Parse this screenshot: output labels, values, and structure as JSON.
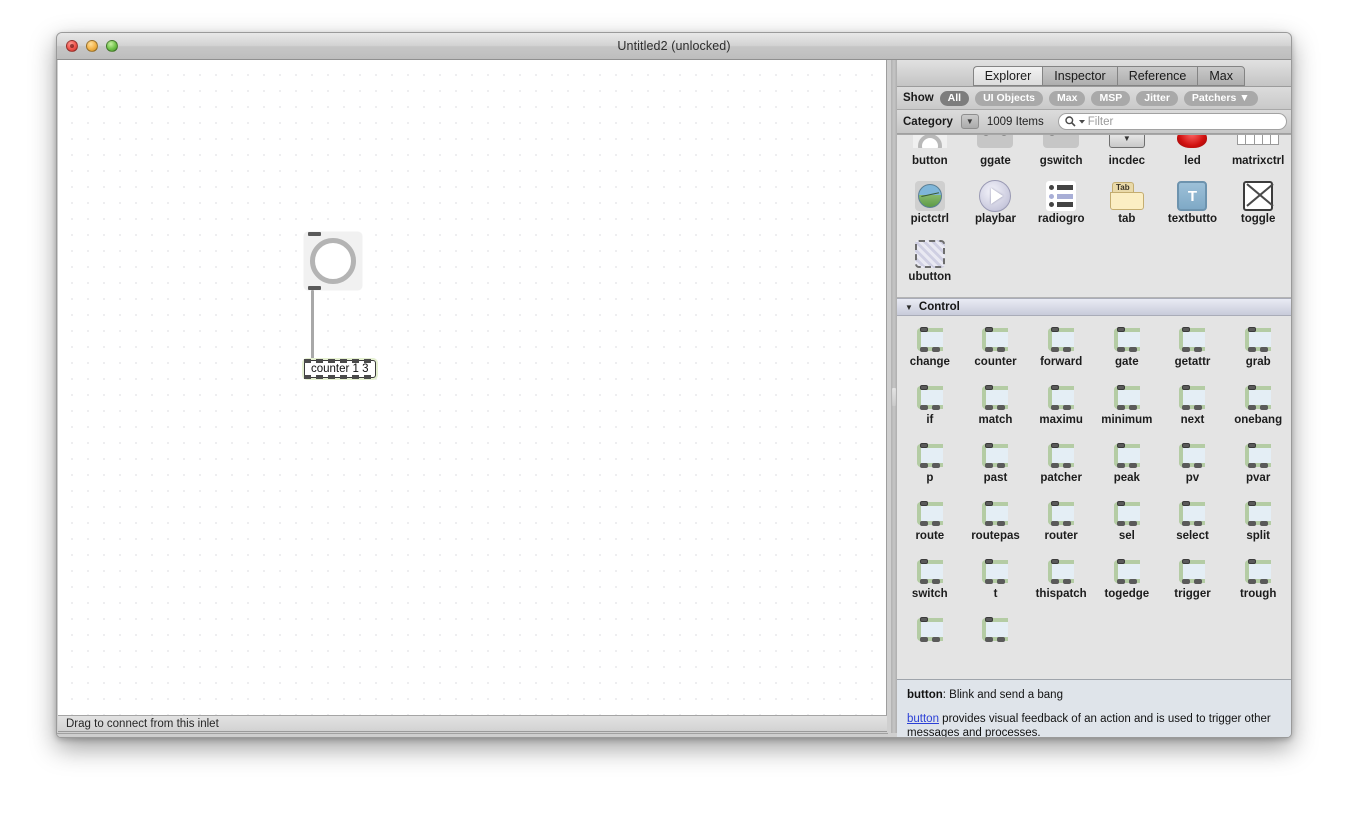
{
  "window": {
    "title": "Untitled2 (unlocked)",
    "traffic_lights": [
      "close",
      "minimize",
      "zoom"
    ]
  },
  "patcher": {
    "status_text": "Drag to connect from this inlet",
    "objects": [
      {
        "type": "bang",
        "name": "button"
      },
      {
        "type": "object-box",
        "text": "counter 1 3",
        "selected": true
      }
    ],
    "toolbar_left": [
      {
        "name": "unlock-edit-icon",
        "glyph": "lock-open"
      },
      {
        "name": "presentation-mode-icon",
        "glyph": "squares"
      },
      {
        "name": "add-object-icon",
        "glyph": "bang-tools"
      },
      {
        "name": "delete-object-icon",
        "glyph": "x-box"
      },
      {
        "name": "signal-probe-icon",
        "glyph": "scope"
      },
      {
        "name": "inspector-icon",
        "glyph": "info"
      },
      {
        "name": "snap-icon",
        "glyph": "pill"
      },
      {
        "name": "grid-icon",
        "glyph": "grid"
      },
      {
        "name": "audio-status-icon",
        "glyph": "meter"
      }
    ],
    "toolbar_right": [
      {
        "name": "bottom-panel-toggle",
        "glyph": "panel-bottom"
      },
      {
        "name": "side-panel-toggle",
        "glyph": "panel-side"
      }
    ]
  },
  "sidebar": {
    "tabs": [
      {
        "label": "Explorer",
        "active": true
      },
      {
        "label": "Inspector",
        "active": false
      },
      {
        "label": "Reference",
        "active": false
      },
      {
        "label": "Max",
        "active": false
      }
    ],
    "show": {
      "label": "Show",
      "filters": [
        {
          "label": "All",
          "active": true
        },
        {
          "label": "UI Objects",
          "active": false
        },
        {
          "label": "Max",
          "active": false
        },
        {
          "label": "MSP",
          "active": false
        },
        {
          "label": "Jitter",
          "active": false
        },
        {
          "label": "Patchers ▼",
          "active": false
        }
      ]
    },
    "category": {
      "label": "Category",
      "arrow": "▼",
      "items_count": "1009 Items",
      "search_placeholder": "Filter",
      "search_value": ""
    },
    "ui_objects": [
      {
        "label": "button",
        "icon": "bang-icon"
      },
      {
        "label": "ggate",
        "icon": "ggate-icon"
      },
      {
        "label": "gswitch",
        "icon": "gswitch-icon"
      },
      {
        "label": "incdec",
        "icon": "incdec-icon"
      },
      {
        "label": "led",
        "icon": "led-icon"
      },
      {
        "label": "matrixctrl",
        "icon": "matrixctrl-icon"
      },
      {
        "label": "pictctrl",
        "icon": "pictctrl-icon"
      },
      {
        "label": "playbar",
        "icon": "playbar-icon"
      },
      {
        "label": "radiogro",
        "icon": "radiogroup-icon"
      },
      {
        "label": "tab",
        "icon": "tab-icon"
      },
      {
        "label": "textbutto",
        "icon": "textbutton-icon"
      },
      {
        "label": "toggle",
        "icon": "toggle-icon"
      },
      {
        "label": "ubutton",
        "icon": "ubutton-icon"
      }
    ],
    "control_section": {
      "title": "Control",
      "expanded": true,
      "triangle": "▼",
      "objects": [
        "change",
        "counter",
        "forward",
        "gate",
        "getattr",
        "grab",
        "if",
        "match",
        "maximu",
        "minimum",
        "next",
        "onebang",
        "p",
        "past",
        "patcher",
        "peak",
        "pv",
        "pvar",
        "route",
        "routepas",
        "router",
        "sel",
        "select",
        "split",
        "switch",
        "t",
        "thispatch",
        "togedge",
        "trigger",
        "trough",
        "",
        ""
      ]
    },
    "info": {
      "title_object": "button",
      "title_sep": ": ",
      "title_desc": "Blink and send a bang",
      "link": "button",
      "body": " provides visual feedback of an action and is used to trigger other messages and processes."
    },
    "toolbar": [
      {
        "name": "settings-gear-icon"
      },
      {
        "name": "icon-view-icon"
      },
      {
        "name": "list-view-icon"
      },
      {
        "name": "preview-eye-icon"
      },
      {
        "name": "add-icon"
      },
      {
        "name": "help-icon"
      },
      {
        "name": "menu-icon"
      }
    ]
  },
  "colors": {
    "accent_blue": "#2b3fd6",
    "object_green": "#b4cca4",
    "object_body": "#e4eef5",
    "led_red": "#d1100f",
    "selection_halo": "#e4efd0"
  }
}
